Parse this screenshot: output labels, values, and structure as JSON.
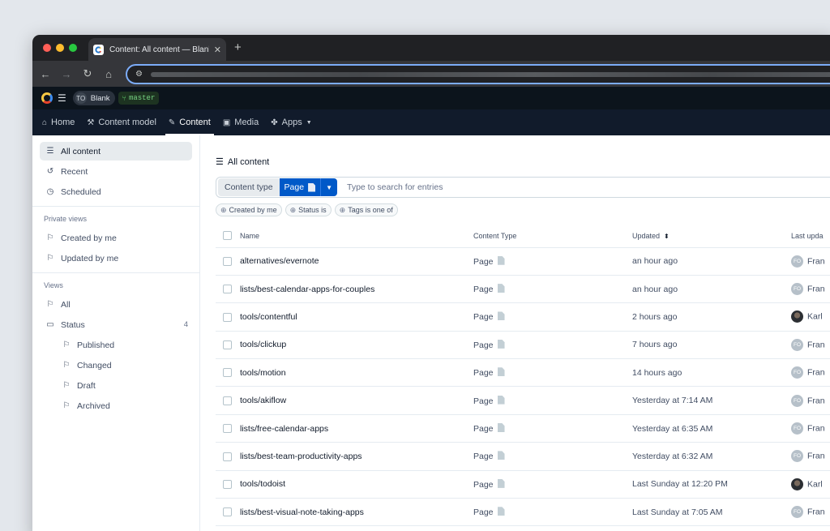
{
  "browser": {
    "tab_title": "Content: All content — Blank",
    "tab_close": "✕",
    "new_tab": "+",
    "nav": {
      "back": "←",
      "forward": "→",
      "reload": "↻",
      "home": "⌂"
    }
  },
  "app_header": {
    "space_initials": "TO",
    "space_name": "Blank",
    "environment": "master"
  },
  "nav": {
    "items": [
      {
        "label": "Home",
        "icon": "home-icon"
      },
      {
        "label": "Content model",
        "icon": "wrench-icon"
      },
      {
        "label": "Content",
        "icon": "pen-icon",
        "active": true
      },
      {
        "label": "Media",
        "icon": "image-icon"
      },
      {
        "label": "Apps",
        "icon": "apps-icon"
      }
    ]
  },
  "sidebar": {
    "top": [
      {
        "label": "All content",
        "active": true
      },
      {
        "label": "Recent"
      },
      {
        "label": "Scheduled"
      }
    ],
    "private_views_heading": "Private views",
    "private_views": [
      {
        "label": "Created by me"
      },
      {
        "label": "Updated by me"
      }
    ],
    "views_heading": "Views",
    "views_all": "All",
    "status_folder": {
      "label": "Status",
      "count": "4"
    },
    "status_views": [
      {
        "label": "Published"
      },
      {
        "label": "Changed"
      },
      {
        "label": "Draft"
      },
      {
        "label": "Archived"
      }
    ]
  },
  "main": {
    "title": "All content",
    "search": {
      "content_type_label": "Content type",
      "content_type_value": "Page",
      "placeholder": "Type to search for entries"
    },
    "filters": [
      "Created by me",
      "Status is",
      "Tags is one of"
    ],
    "columns": {
      "name": "Name",
      "content_type": "Content Type",
      "updated": "Updated",
      "last_updated_by": "Last upda"
    },
    "rows": [
      {
        "name": "alternatives/evernote",
        "type": "Page",
        "updated": "an hour ago",
        "user_initials": "FO",
        "user": "Fran"
      },
      {
        "name": "lists/best-calendar-apps-for-couples",
        "type": "Page",
        "updated": "an hour ago",
        "user_initials": "FO",
        "user": "Fran"
      },
      {
        "name": "tools/contentful",
        "type": "Page",
        "updated": "2 hours ago",
        "user_initials": "",
        "user": "Karl"
      },
      {
        "name": "tools/clickup",
        "type": "Page",
        "updated": "7 hours ago",
        "user_initials": "FO",
        "user": "Fran"
      },
      {
        "name": "tools/motion",
        "type": "Page",
        "updated": "14 hours ago",
        "user_initials": "FO",
        "user": "Fran"
      },
      {
        "name": "tools/akiflow",
        "type": "Page",
        "updated": "Yesterday at 7:14 AM",
        "user_initials": "FO",
        "user": "Fran"
      },
      {
        "name": "lists/free-calendar-apps",
        "type": "Page",
        "updated": "Yesterday at 6:35 AM",
        "user_initials": "FO",
        "user": "Fran"
      },
      {
        "name": "lists/best-team-productivity-apps",
        "type": "Page",
        "updated": "Yesterday at 6:32 AM",
        "user_initials": "FO",
        "user": "Fran"
      },
      {
        "name": "tools/todoist",
        "type": "Page",
        "updated": "Last Sunday at 12:20 PM",
        "user_initials": "",
        "user": "Karl"
      },
      {
        "name": "lists/best-visual-note-taking-apps",
        "type": "Page",
        "updated": "Last Sunday at 7:05 AM",
        "user_initials": "FO",
        "user": "Fran"
      }
    ]
  },
  "colors": {
    "accent": "#0059c8",
    "header": "#0c141c",
    "nav": "#111b2b"
  }
}
